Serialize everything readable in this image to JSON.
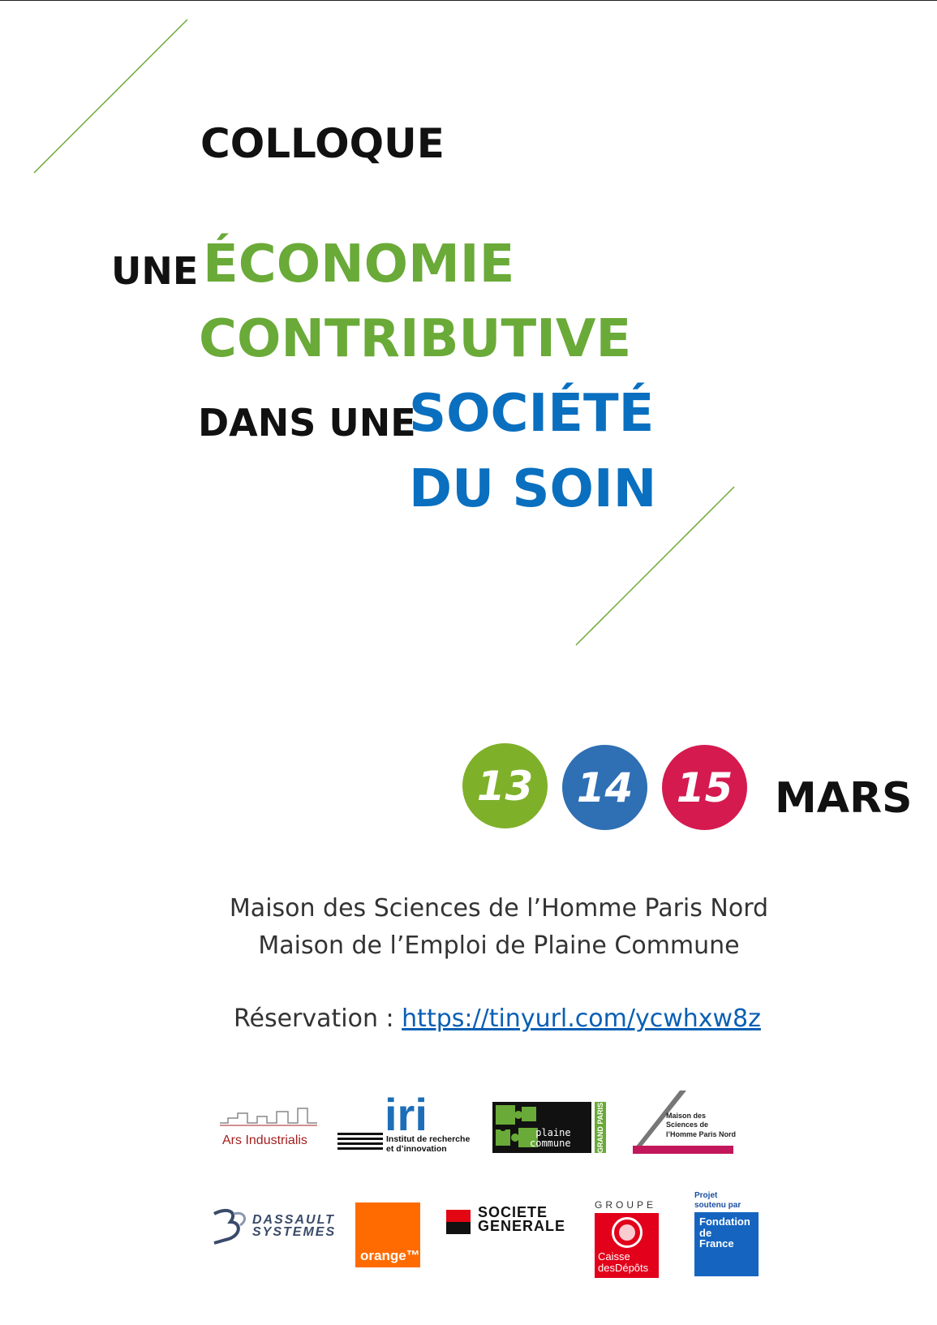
{
  "heading": {
    "colloque": "COLLOQUE",
    "une": "UNE",
    "economie": "ÉCONOMIE",
    "contributive": "CONTRIBUTIVE",
    "dans_une": "DANS UNE",
    "societe": "SOCIÉTÉ",
    "du_soin": "DU SOIN"
  },
  "dates": {
    "days": [
      "13",
      "14",
      "15"
    ],
    "month": "MARS"
  },
  "venue": {
    "line1": "Maison des Sciences de l’Homme Paris Nord",
    "line2": "Maison de l’Emploi de Plaine Commune"
  },
  "reservation": {
    "label": "Réservation : ",
    "url": "https://tinyurl.com/ycwhxw8z"
  },
  "partners": {
    "ars_industrialis": "Ars Industrialis",
    "iri": "iri",
    "iri_sub": "Institut de recherche\net d’innovation",
    "plaine_commune": "plaine\ncommune",
    "grand_paris": "GRAND PARIS",
    "msh": "Maison des\nSciences de\nl’Homme Paris Nord",
    "dassault": "DASSAULT\nSYSTEMES",
    "orange": "orange™",
    "societe_generale": "SOCIETE\nGENERALE",
    "cdc_groupe": "GROUPE",
    "cdc_name": "Caisse\ndesDépôts",
    "fdf_label": "Projet\nsoutenu par",
    "fdf_name": "Fondation\nde\nFrance"
  },
  "colors": {
    "green": "#6aaa38",
    "blue": "#0a6fbf",
    "day1": "#7fb02a",
    "day2": "#2f6fb4",
    "day3": "#d51a50"
  }
}
